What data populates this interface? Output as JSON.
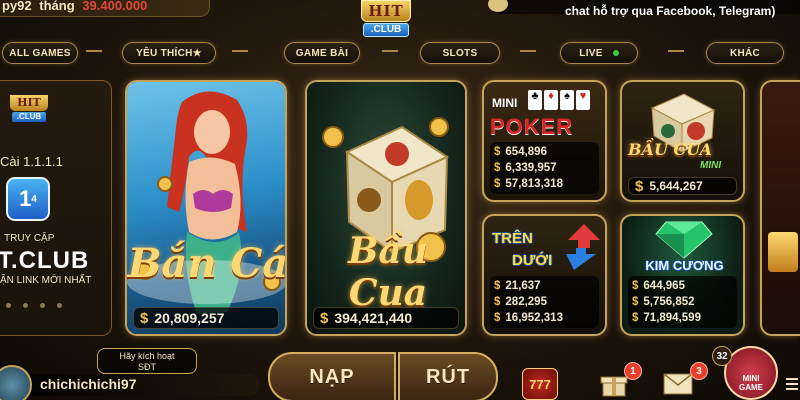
{
  "header": {
    "username_fragment": "py92",
    "month_label": "tháng",
    "month_amount": "39.400.000",
    "logo_main": "HIT",
    "logo_sub": ".CLUB",
    "support_text": "chat hỗ trợ qua Facebook, Telegram)"
  },
  "nav": {
    "tabs": [
      {
        "label": "ALL GAMES"
      },
      {
        "label": "YÊU THÍCH★"
      },
      {
        "label": "GAME BÀI"
      },
      {
        "label": "SLOTS"
      },
      {
        "label": "LIVE"
      },
      {
        "label": "KHÁC"
      }
    ]
  },
  "promo": {
    "logo_main": "HIT",
    "logo_sub": ".CLUB",
    "install_text": "Cài 1.1.1.1",
    "app_icon_text": "1",
    "app_icon_sup": "4",
    "access_label": "TRUY CẬP",
    "club_text": "T.CLUB",
    "link_text": "ẬN LINK MỚI NHẤT"
  },
  "games": {
    "ban_ca": {
      "title": "Bắn Cá",
      "jackpot": "20,809,257"
    },
    "bau_cua": {
      "title": "Bầu Cua",
      "jackpot": "394,421,440"
    },
    "mini_poker": {
      "title_top": "MINI",
      "title_main": "POKER",
      "jackpots": [
        "654,896",
        "6,339,957",
        "57,813,318"
      ]
    },
    "bau_cua_mini": {
      "title_main": "BẦU CUA",
      "title_sub": "MINI",
      "jackpot": "5,644,267"
    },
    "tren_duoi": {
      "title_top": "TRÊN",
      "title_bottom": "DƯỚI",
      "jackpots": [
        "21,637",
        "282,295",
        "16,952,313"
      ]
    },
    "kim_cuong": {
      "title": "KIM CƯƠNG",
      "jackpots": [
        "644,965",
        "5,756,852",
        "71,894,599"
      ]
    },
    "currency_symbol": "$"
  },
  "bottom": {
    "activate_line1": "Hãy kích hoạt",
    "activate_line2": "SĐT",
    "username": "chichichichi97",
    "deposit_label": "NẠP",
    "withdraw_label": "RÚT",
    "slot_icon_text": "777",
    "gift_badge": "1",
    "mail_badge": "3",
    "mini_game_badge": "32",
    "mini_game_line1": "MINI",
    "mini_game_line2": "GAME"
  },
  "colors": {
    "gold_border": "#c7a35a",
    "accent_red": "#e5463a",
    "jackpot_gold": "#f1c14b",
    "live_green": "#35d03a"
  }
}
